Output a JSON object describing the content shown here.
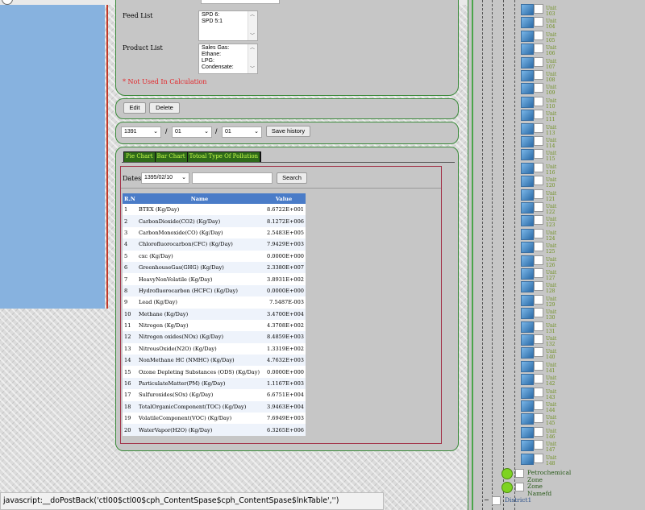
{
  "form": {
    "feed_label": "Feed List",
    "feed_items": [
      "SPD 6:",
      "SPD 5:1"
    ],
    "product_label": "Product List",
    "product_items": [
      "Sales Gas:",
      "Ethane:",
      "LPG:",
      "Condensate:"
    ],
    "note": "* Not Used In Calculation"
  },
  "actions": {
    "edit": "Edit",
    "delete": "Delete"
  },
  "history": {
    "year": "1391",
    "month": "01",
    "day": "01",
    "save": "Save history"
  },
  "tabs": [
    "Pie Chart",
    "Bar Chart",
    "Totoal Type Of Pollution"
  ],
  "search": {
    "dates_label": "Dates:",
    "date_value": "1395/02/10",
    "button": "Search"
  },
  "table": {
    "headers": [
      "R.N",
      "Name",
      "Value"
    ],
    "rows": [
      [
        "1",
        "BTEX (Kg/Day)",
        "8.6722E+001"
      ],
      [
        "2",
        "CarbonDioxide(CO2) (Kg/Day)",
        "8.1272E+006"
      ],
      [
        "3",
        "CarbonMonoxide(CO) (Kg/Day)",
        "2.5483E+005"
      ],
      [
        "4",
        "Chlorofluorocarbon(CFC) (Kg/Day)",
        "7.9429E+003"
      ],
      [
        "5",
        "cxc (Kg/Day)",
        "0.0000E+000"
      ],
      [
        "6",
        "GreenhouseGas(GHG) (Kg/Day)",
        "2.3380E+007"
      ],
      [
        "7",
        "HeavyNonVolatile (Kg/Day)",
        "3.8931E+002"
      ],
      [
        "8",
        "Hydrofluorocarbon (HCFC) (Kg/Day)",
        "0.0000E+000"
      ],
      [
        "9",
        "Lead (Kg/Day)",
        "7.5487E-003"
      ],
      [
        "10",
        "Methane (Kg/Day)",
        "3.4700E+004"
      ],
      [
        "11",
        "Nitrogen (Kg/Day)",
        "4.3708E+002"
      ],
      [
        "12",
        "Nitrogen oxides(NOx) (Kg/Day)",
        "8.4859E+003"
      ],
      [
        "13",
        "NitrousOxide(N2O) (Kg/Day)",
        "1.3319E+002"
      ],
      [
        "14",
        "NonMethane HC (NMHC) (Kg/Day)",
        "4.7632E+003"
      ],
      [
        "15",
        "Ozone Depleting Substances (ODS) (Kg/Day)",
        "0.0000E+000"
      ],
      [
        "16",
        "ParticulateMatter(PM) (Kg/Day)",
        "1.1167E+003"
      ],
      [
        "17",
        "Sulfuroxides(SOx) (Kg/Day)",
        "6.6751E+004"
      ],
      [
        "18",
        "TotalOrganicComponent(TOC) (Kg/Day)",
        "3.9463E+004"
      ],
      [
        "19",
        "VolatileComponent(VOC) (Kg/Day)",
        "7.6949E+003"
      ],
      [
        "20",
        "WaterVapor(H2O) (Kg/Day)",
        "6.3265E+006"
      ]
    ]
  },
  "tree": {
    "units": [
      "Unit 103",
      "Unit 104",
      "Unit 105",
      "Unit 106",
      "Unit 107",
      "Unit 108",
      "Unit 109",
      "Unit 110",
      "Unit 111",
      "Unit 113",
      "Unit 114",
      "Unit 115",
      "Unit 116",
      "Unit 120",
      "Unit 121",
      "Unit 122",
      "Unit 123",
      "Unit 124",
      "Unit 125",
      "Unit 126",
      "Unit 127",
      "Unit 128",
      "Unit 129",
      "Unit 130",
      "Unit 131",
      "Unit 132",
      "Unit 140",
      "Unit 141",
      "Unit 142",
      "Unit 143",
      "Unit 144",
      "Unit 145",
      "Unit 146",
      "Unit 147",
      "Unit 148"
    ],
    "zones": [
      "Petrochemical Zone",
      "Zone Namefd"
    ],
    "district": "District1"
  },
  "status_bar": "javascript:__doPostBack('ctl00$ctl00$cph_ContentSpase$cph_ContentSpase$lnkTable','')"
}
